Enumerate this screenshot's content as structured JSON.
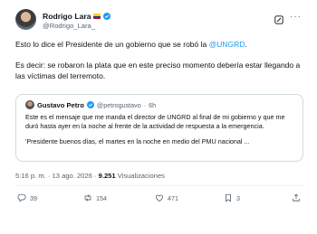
{
  "author": {
    "name": "Rodrigo Lara",
    "handle": "@Rodrigo_Lara_"
  },
  "tweet": {
    "text_1_prefix": "Esto lo dice el Presidente de un gobierno que se robó la ",
    "text_1_link": "@UNGRD",
    "text_1_suffix": ".",
    "text_2": "Es decir: se robaron la plata que en este preciso momento debería estar llegando a las víctimas del terremoto."
  },
  "quote": {
    "name": "Gustavo Petro",
    "handle": "@petrogustavo",
    "separator": "·",
    "time": "6h",
    "text_1": "Este es el mensaje que me manda el director de UNGRD al final de mi gobierno y que me duró hasta ayer en la noche al frente de la actividad de respuesta a la emergencia.",
    "text_2": "'Presidente buenos días, el martes en  la noche en medio del PMU nacional ..."
  },
  "meta": {
    "timestamp": "5:16 p. m. · 13 ago. 2026 ·",
    "views_count": "9.251",
    "views_label": "Visualizaciones"
  },
  "actions": {
    "replies": "39",
    "retweets": "154",
    "likes": "471",
    "bookmarks": "3"
  },
  "colors": {
    "accent": "#1d9bf0",
    "text": "#0f1419",
    "secondary": "#536471",
    "border": "#cfd9de"
  }
}
